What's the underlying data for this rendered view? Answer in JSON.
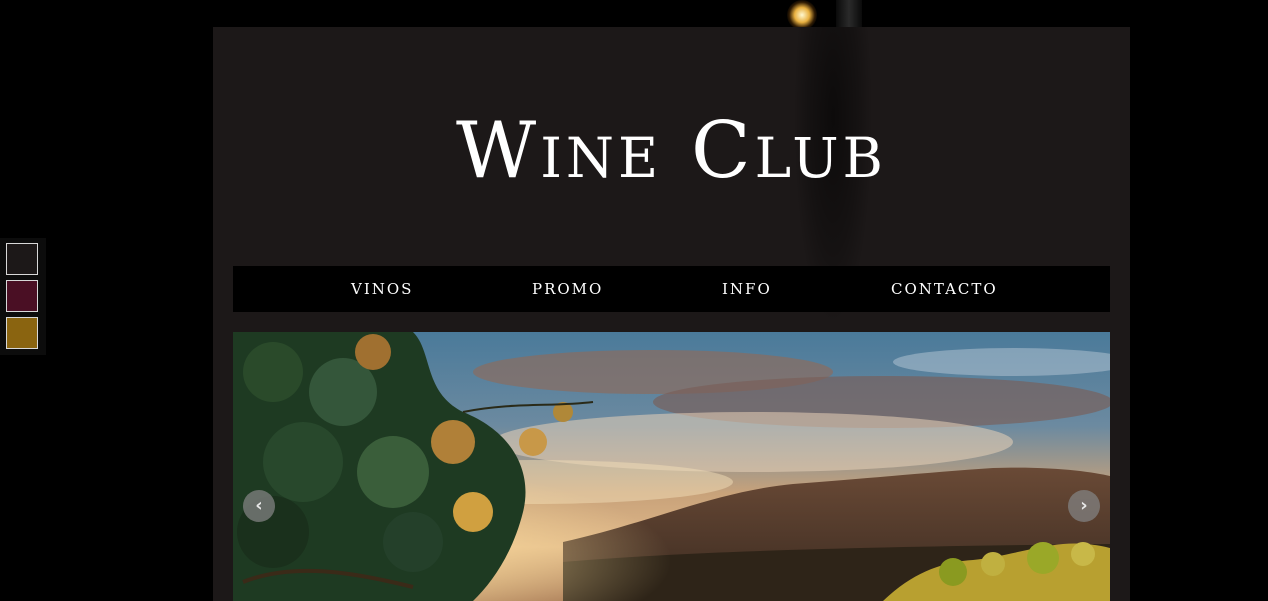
{
  "site": {
    "title": "Wine Club"
  },
  "nav": {
    "items": [
      {
        "label": "VINOS"
      },
      {
        "label": "PROMO"
      },
      {
        "label": "INFO"
      },
      {
        "label": "CONTACTO"
      }
    ]
  },
  "carousel": {
    "prev_icon": "chevron-left-icon",
    "next_icon": "chevron-right-icon",
    "prev_glyph": "‹",
    "next_glyph": "›"
  },
  "theme_swatches": [
    {
      "color": "#1c1818"
    },
    {
      "color": "#4a0f24"
    },
    {
      "color": "#8a6410"
    }
  ],
  "colors": {
    "background": "#000000",
    "panel": "#1c1818",
    "nav_background": "#000000",
    "text": "#ffffff"
  }
}
